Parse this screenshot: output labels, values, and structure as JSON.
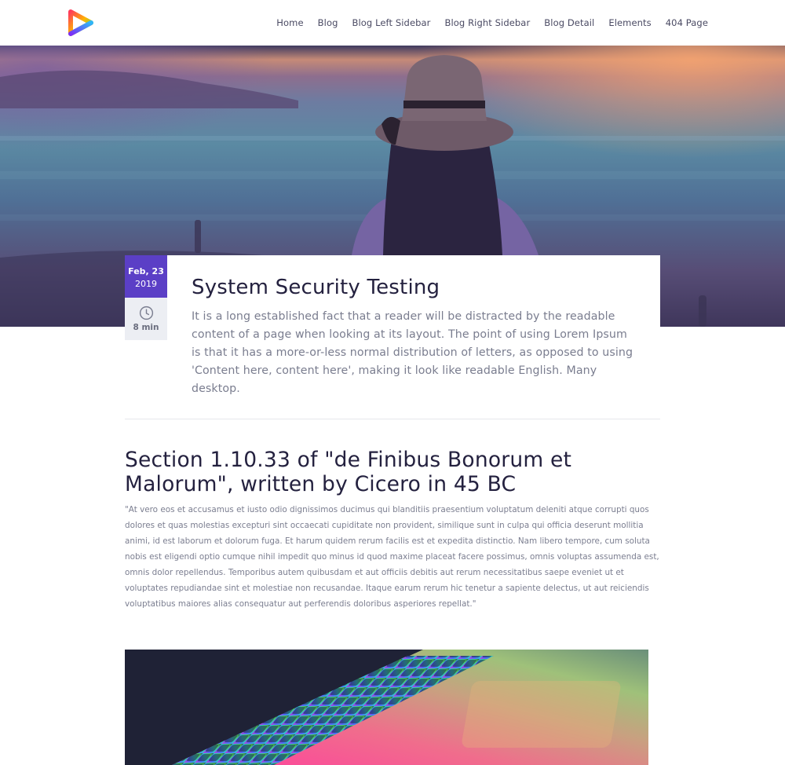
{
  "header": {
    "logo_icon": "play-triangle-logo-icon",
    "nav": [
      {
        "label": "Home"
      },
      {
        "label": "Blog"
      },
      {
        "label": "Blog Left Sidebar"
      },
      {
        "label": "Blog Right Sidebar"
      },
      {
        "label": "Blog Detail"
      },
      {
        "label": "Elements"
      },
      {
        "label": "404 Page"
      }
    ]
  },
  "post": {
    "date_day": "Feb, 23",
    "date_year": "2019",
    "read_icon": "clock-icon",
    "read_time": "8 min",
    "title": "System Security Testing",
    "excerpt": "It is a long established fact that a reader will be distracted by the readable content of a page when looking at its layout. The point of using Lorem Ipsum is that it has a more-or-less normal distribution of letters, as opposed to using 'Content here, content here', making it look like readable English. Many desktop."
  },
  "section": {
    "title": "Section 1.10.33 of \"de Finibus Bonorum et Malorum\", written by Cicero in 45 BC",
    "body": "\"At vero eos et accusamus et iusto odio dignissimos ducimus qui blanditiis praesentium voluptatum deleniti atque corrupti quos dolores et quas molestias excepturi sint occaecati cupiditate non provident, similique sunt in culpa qui officia deserunt mollitia animi, id est laborum et dolorum fuga. Et harum quidem rerum facilis est et expedita distinctio. Nam libero tempore, cum soluta nobis est eligendi optio cumque nihil impedit quo minus id quod maxime placeat facere possimus, omnis voluptas assumenda est, omnis dolor repellendus. Temporibus autem quibusdam et aut officiis debitis aut rerum necessitatibus saepe eveniet ut et voluptates repudiandae sint et molestiae non recusandae. Itaque earum rerum hic tenetur a sapiente delectus, ut aut reiciendis voluptatibus maiores alias consequatur aut perferendis doloribus asperiores repellat.\""
  },
  "colors": {
    "accent": "#5b3fc6",
    "heading": "#24213f",
    "body_text": "#7a7d8f",
    "read_box_bg": "#eceef3"
  }
}
